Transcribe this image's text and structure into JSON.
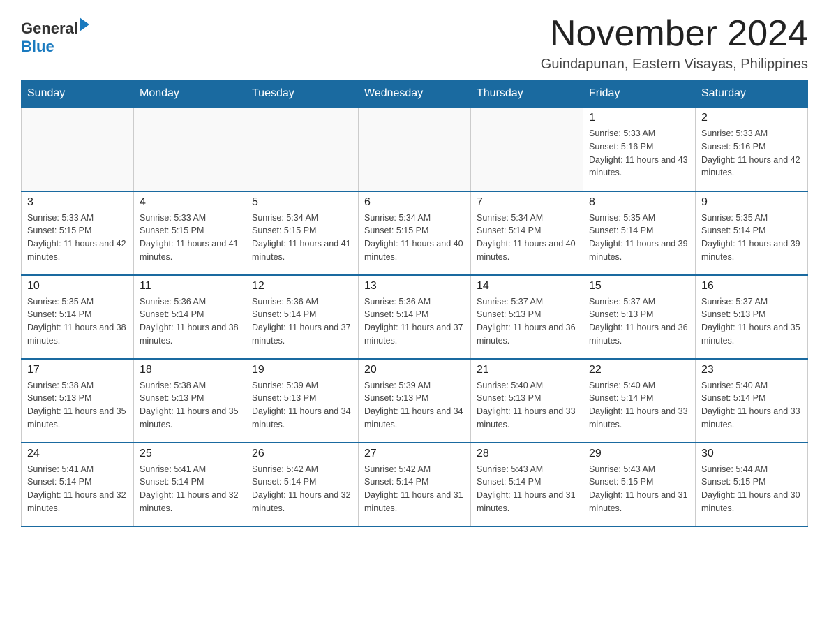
{
  "logo": {
    "general": "General",
    "blue": "Blue"
  },
  "title": "November 2024",
  "subtitle": "Guindapunan, Eastern Visayas, Philippines",
  "days_of_week": [
    "Sunday",
    "Monday",
    "Tuesday",
    "Wednesday",
    "Thursday",
    "Friday",
    "Saturday"
  ],
  "weeks": [
    [
      {
        "day": "",
        "sunrise": "",
        "sunset": "",
        "daylight": ""
      },
      {
        "day": "",
        "sunrise": "",
        "sunset": "",
        "daylight": ""
      },
      {
        "day": "",
        "sunrise": "",
        "sunset": "",
        "daylight": ""
      },
      {
        "day": "",
        "sunrise": "",
        "sunset": "",
        "daylight": ""
      },
      {
        "day": "",
        "sunrise": "",
        "sunset": "",
        "daylight": ""
      },
      {
        "day": "1",
        "sunrise": "Sunrise: 5:33 AM",
        "sunset": "Sunset: 5:16 PM",
        "daylight": "Daylight: 11 hours and 43 minutes."
      },
      {
        "day": "2",
        "sunrise": "Sunrise: 5:33 AM",
        "sunset": "Sunset: 5:16 PM",
        "daylight": "Daylight: 11 hours and 42 minutes."
      }
    ],
    [
      {
        "day": "3",
        "sunrise": "Sunrise: 5:33 AM",
        "sunset": "Sunset: 5:15 PM",
        "daylight": "Daylight: 11 hours and 42 minutes."
      },
      {
        "day": "4",
        "sunrise": "Sunrise: 5:33 AM",
        "sunset": "Sunset: 5:15 PM",
        "daylight": "Daylight: 11 hours and 41 minutes."
      },
      {
        "day": "5",
        "sunrise": "Sunrise: 5:34 AM",
        "sunset": "Sunset: 5:15 PM",
        "daylight": "Daylight: 11 hours and 41 minutes."
      },
      {
        "day": "6",
        "sunrise": "Sunrise: 5:34 AM",
        "sunset": "Sunset: 5:15 PM",
        "daylight": "Daylight: 11 hours and 40 minutes."
      },
      {
        "day": "7",
        "sunrise": "Sunrise: 5:34 AM",
        "sunset": "Sunset: 5:14 PM",
        "daylight": "Daylight: 11 hours and 40 minutes."
      },
      {
        "day": "8",
        "sunrise": "Sunrise: 5:35 AM",
        "sunset": "Sunset: 5:14 PM",
        "daylight": "Daylight: 11 hours and 39 minutes."
      },
      {
        "day": "9",
        "sunrise": "Sunrise: 5:35 AM",
        "sunset": "Sunset: 5:14 PM",
        "daylight": "Daylight: 11 hours and 39 minutes."
      }
    ],
    [
      {
        "day": "10",
        "sunrise": "Sunrise: 5:35 AM",
        "sunset": "Sunset: 5:14 PM",
        "daylight": "Daylight: 11 hours and 38 minutes."
      },
      {
        "day": "11",
        "sunrise": "Sunrise: 5:36 AM",
        "sunset": "Sunset: 5:14 PM",
        "daylight": "Daylight: 11 hours and 38 minutes."
      },
      {
        "day": "12",
        "sunrise": "Sunrise: 5:36 AM",
        "sunset": "Sunset: 5:14 PM",
        "daylight": "Daylight: 11 hours and 37 minutes."
      },
      {
        "day": "13",
        "sunrise": "Sunrise: 5:36 AM",
        "sunset": "Sunset: 5:14 PM",
        "daylight": "Daylight: 11 hours and 37 minutes."
      },
      {
        "day": "14",
        "sunrise": "Sunrise: 5:37 AM",
        "sunset": "Sunset: 5:13 PM",
        "daylight": "Daylight: 11 hours and 36 minutes."
      },
      {
        "day": "15",
        "sunrise": "Sunrise: 5:37 AM",
        "sunset": "Sunset: 5:13 PM",
        "daylight": "Daylight: 11 hours and 36 minutes."
      },
      {
        "day": "16",
        "sunrise": "Sunrise: 5:37 AM",
        "sunset": "Sunset: 5:13 PM",
        "daylight": "Daylight: 11 hours and 35 minutes."
      }
    ],
    [
      {
        "day": "17",
        "sunrise": "Sunrise: 5:38 AM",
        "sunset": "Sunset: 5:13 PM",
        "daylight": "Daylight: 11 hours and 35 minutes."
      },
      {
        "day": "18",
        "sunrise": "Sunrise: 5:38 AM",
        "sunset": "Sunset: 5:13 PM",
        "daylight": "Daylight: 11 hours and 35 minutes."
      },
      {
        "day": "19",
        "sunrise": "Sunrise: 5:39 AM",
        "sunset": "Sunset: 5:13 PM",
        "daylight": "Daylight: 11 hours and 34 minutes."
      },
      {
        "day": "20",
        "sunrise": "Sunrise: 5:39 AM",
        "sunset": "Sunset: 5:13 PM",
        "daylight": "Daylight: 11 hours and 34 minutes."
      },
      {
        "day": "21",
        "sunrise": "Sunrise: 5:40 AM",
        "sunset": "Sunset: 5:13 PM",
        "daylight": "Daylight: 11 hours and 33 minutes."
      },
      {
        "day": "22",
        "sunrise": "Sunrise: 5:40 AM",
        "sunset": "Sunset: 5:14 PM",
        "daylight": "Daylight: 11 hours and 33 minutes."
      },
      {
        "day": "23",
        "sunrise": "Sunrise: 5:40 AM",
        "sunset": "Sunset: 5:14 PM",
        "daylight": "Daylight: 11 hours and 33 minutes."
      }
    ],
    [
      {
        "day": "24",
        "sunrise": "Sunrise: 5:41 AM",
        "sunset": "Sunset: 5:14 PM",
        "daylight": "Daylight: 11 hours and 32 minutes."
      },
      {
        "day": "25",
        "sunrise": "Sunrise: 5:41 AM",
        "sunset": "Sunset: 5:14 PM",
        "daylight": "Daylight: 11 hours and 32 minutes."
      },
      {
        "day": "26",
        "sunrise": "Sunrise: 5:42 AM",
        "sunset": "Sunset: 5:14 PM",
        "daylight": "Daylight: 11 hours and 32 minutes."
      },
      {
        "day": "27",
        "sunrise": "Sunrise: 5:42 AM",
        "sunset": "Sunset: 5:14 PM",
        "daylight": "Daylight: 11 hours and 31 minutes."
      },
      {
        "day": "28",
        "sunrise": "Sunrise: 5:43 AM",
        "sunset": "Sunset: 5:14 PM",
        "daylight": "Daylight: 11 hours and 31 minutes."
      },
      {
        "day": "29",
        "sunrise": "Sunrise: 5:43 AM",
        "sunset": "Sunset: 5:15 PM",
        "daylight": "Daylight: 11 hours and 31 minutes."
      },
      {
        "day": "30",
        "sunrise": "Sunrise: 5:44 AM",
        "sunset": "Sunset: 5:15 PM",
        "daylight": "Daylight: 11 hours and 30 minutes."
      }
    ]
  ]
}
